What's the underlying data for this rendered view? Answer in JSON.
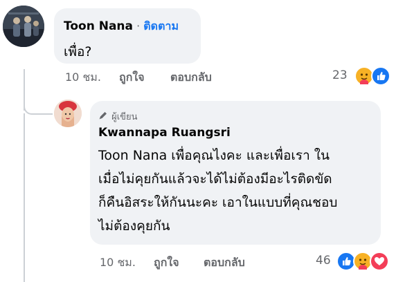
{
  "comment": {
    "author": "Toon Nana",
    "separator": "·",
    "follow_label": "ติดตาม",
    "text": "เพื่อ?",
    "time": "10 ชม.",
    "like_label": "ถูกใจ",
    "reply_label": "ตอบกลับ",
    "reaction_count": "23",
    "reactions": [
      "care-icon",
      "like-icon"
    ]
  },
  "reply": {
    "author_badge": "ผู้เขียน",
    "author": "Kwannapa Ruangsri",
    "lines": [
      "Toon Nana เพื่อคุณไงคะ และเพื่อเรา ใน",
      "เมื่อไม่คุยกันแล้วจะได้ไม่ต้องมีอะไรติดขัด",
      "ก็คืนอิสระให้กันนะคะ เอาในแบบที่คุณชอบ",
      "ไม่ต้องคุยกัน"
    ],
    "time": "10 ชม.",
    "like_label": "ถูกใจ",
    "reply_label": "ตอบกลับ",
    "reaction_count": "46",
    "reactions": [
      "like-icon",
      "care-icon",
      "love-icon"
    ]
  },
  "colors": {
    "accent": "#1877f2",
    "bubble": "#f0f2f5",
    "muted": "#65676b",
    "love": "#f33e58",
    "care": "#f7b125"
  }
}
